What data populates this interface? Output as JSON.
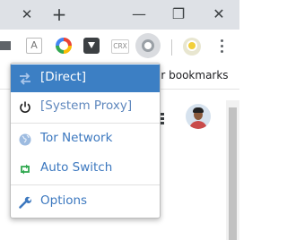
{
  "window": {
    "tab_close_glyph": "✕",
    "new_tab_glyph": "+",
    "minimize_glyph": "—",
    "restore_glyph": "❐",
    "close_glyph": "✕"
  },
  "toolbar": {
    "extensions": [
      {
        "icon": "mail-icon"
      },
      {
        "icon": "translate-icon",
        "text": "A"
      },
      {
        "icon": "color-ring-icon"
      },
      {
        "icon": "download-icon"
      },
      {
        "icon": "crx-icon",
        "text": "CRX"
      },
      {
        "icon": "proxy-omega-icon"
      },
      {
        "icon": "profile-icon"
      }
    ]
  },
  "bookmarks_bar": {
    "other_bookmarks": "er bookmarks"
  },
  "proxy_menu": {
    "items": [
      {
        "label": "[Direct]",
        "icon": "swap-arrows-icon",
        "selected": true
      },
      {
        "label": "[System Proxy]",
        "icon": "power-icon"
      },
      {
        "label": "Tor Network",
        "icon": "globe-icon"
      },
      {
        "label": "Auto Switch",
        "icon": "retweet-icon"
      },
      {
        "label": "Options",
        "icon": "wrench-icon"
      }
    ]
  },
  "colors": {
    "selected_bg": "#3c7fc4",
    "label_blue": "#3c78bf",
    "auto_switch_green": "#2fa84f"
  }
}
